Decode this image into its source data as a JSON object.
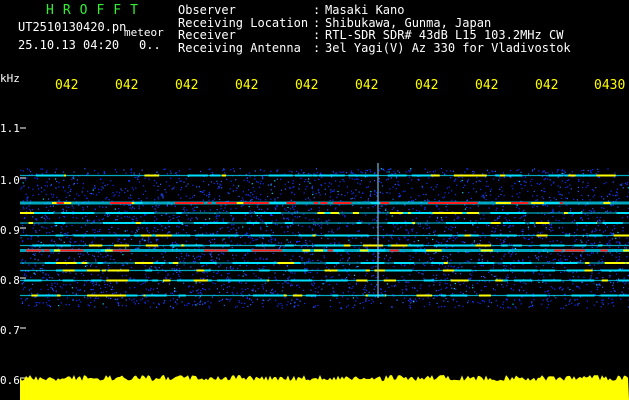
{
  "header": {
    "app_title": "HROFFT",
    "filename": "UT2510130420.pn",
    "tag": "meteor",
    "datetime": "25.10.13 04:20",
    "count": "0.."
  },
  "metadata": [
    {
      "key": "Observer",
      "value": "Masaki Kano"
    },
    {
      "key": "Receiving Location",
      "value": "Shibukawa, Gunma, Japan"
    },
    {
      "key": "Receiver",
      "value": "RTL-SDR SDR# 43dB L15 103.2MHz CW"
    },
    {
      "key": "Receiving Antenna",
      "value": "3el Yagi(V) Az 330 for Vladivostok"
    }
  ],
  "separator": ":",
  "chart_data": {
    "type": "heatmap",
    "ylabel": "kHz",
    "y_ticks": [
      "1.1",
      "1.0",
      "0.9",
      "0.8",
      "0.7",
      "0.6"
    ],
    "x_ticks": [
      "042",
      "042",
      "042",
      "042",
      "042",
      "042",
      "042",
      "042",
      "042",
      "0430"
    ],
    "ylim": [
      0.6,
      1.1
    ],
    "traces_khz": [
      0.95,
      0.93,
      0.91,
      0.885,
      0.865,
      0.855,
      0.83,
      0.815,
      0.795,
      0.765,
      1.005
    ],
    "noise_baseline_color": "#ffff00",
    "colors": {
      "background": "#000010",
      "noise": "#1030ff",
      "mid": "#00e0ff",
      "hot": "#ff2020",
      "warm": "#ffff00"
    }
  }
}
